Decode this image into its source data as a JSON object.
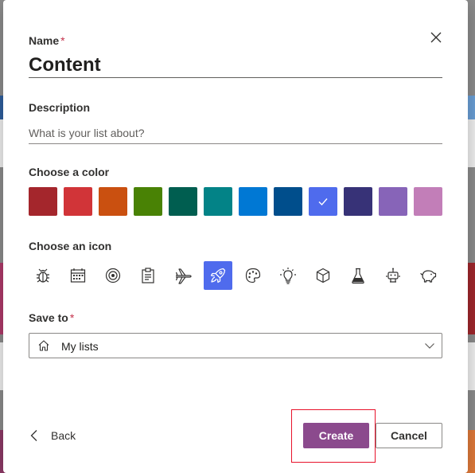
{
  "dialog": {
    "name_label": "Name",
    "required_mark": "*",
    "name_value": "Content",
    "description_label": "Description",
    "description_placeholder": "What is your list about?",
    "color_label": "Choose a color",
    "icon_label": "Choose an icon",
    "save_label": "Save to",
    "save_value": "My lists",
    "back_label": "Back",
    "create_label": "Create",
    "cancel_label": "Cancel"
  },
  "colors": [
    {
      "name": "dark-red",
      "hex": "#a4262c"
    },
    {
      "name": "red",
      "hex": "#d13438"
    },
    {
      "name": "orange",
      "hex": "#ca5010"
    },
    {
      "name": "green",
      "hex": "#498205"
    },
    {
      "name": "dark-teal",
      "hex": "#005e50"
    },
    {
      "name": "teal",
      "hex": "#038387"
    },
    {
      "name": "blue",
      "hex": "#0078d4"
    },
    {
      "name": "dark-blue",
      "hex": "#004e8c"
    },
    {
      "name": "indigo",
      "hex": "#4f6bed",
      "selected": true
    },
    {
      "name": "navy",
      "hex": "#373277"
    },
    {
      "name": "purple",
      "hex": "#8764b8"
    },
    {
      "name": "orchid",
      "hex": "#c27eb8"
    }
  ],
  "icons": [
    {
      "name": "bug-icon"
    },
    {
      "name": "calendar-icon"
    },
    {
      "name": "target-icon"
    },
    {
      "name": "clipboard-icon"
    },
    {
      "name": "airplane-icon"
    },
    {
      "name": "rocket-icon",
      "selected": true
    },
    {
      "name": "palette-icon"
    },
    {
      "name": "lightbulb-icon"
    },
    {
      "name": "cube-icon"
    },
    {
      "name": "flask-icon"
    },
    {
      "name": "robot-icon"
    },
    {
      "name": "piggy-bank-icon"
    }
  ],
  "accent": {
    "create_button": "#8b4a8d",
    "highlight_box": "#e8122b",
    "required": "#c4314b"
  }
}
